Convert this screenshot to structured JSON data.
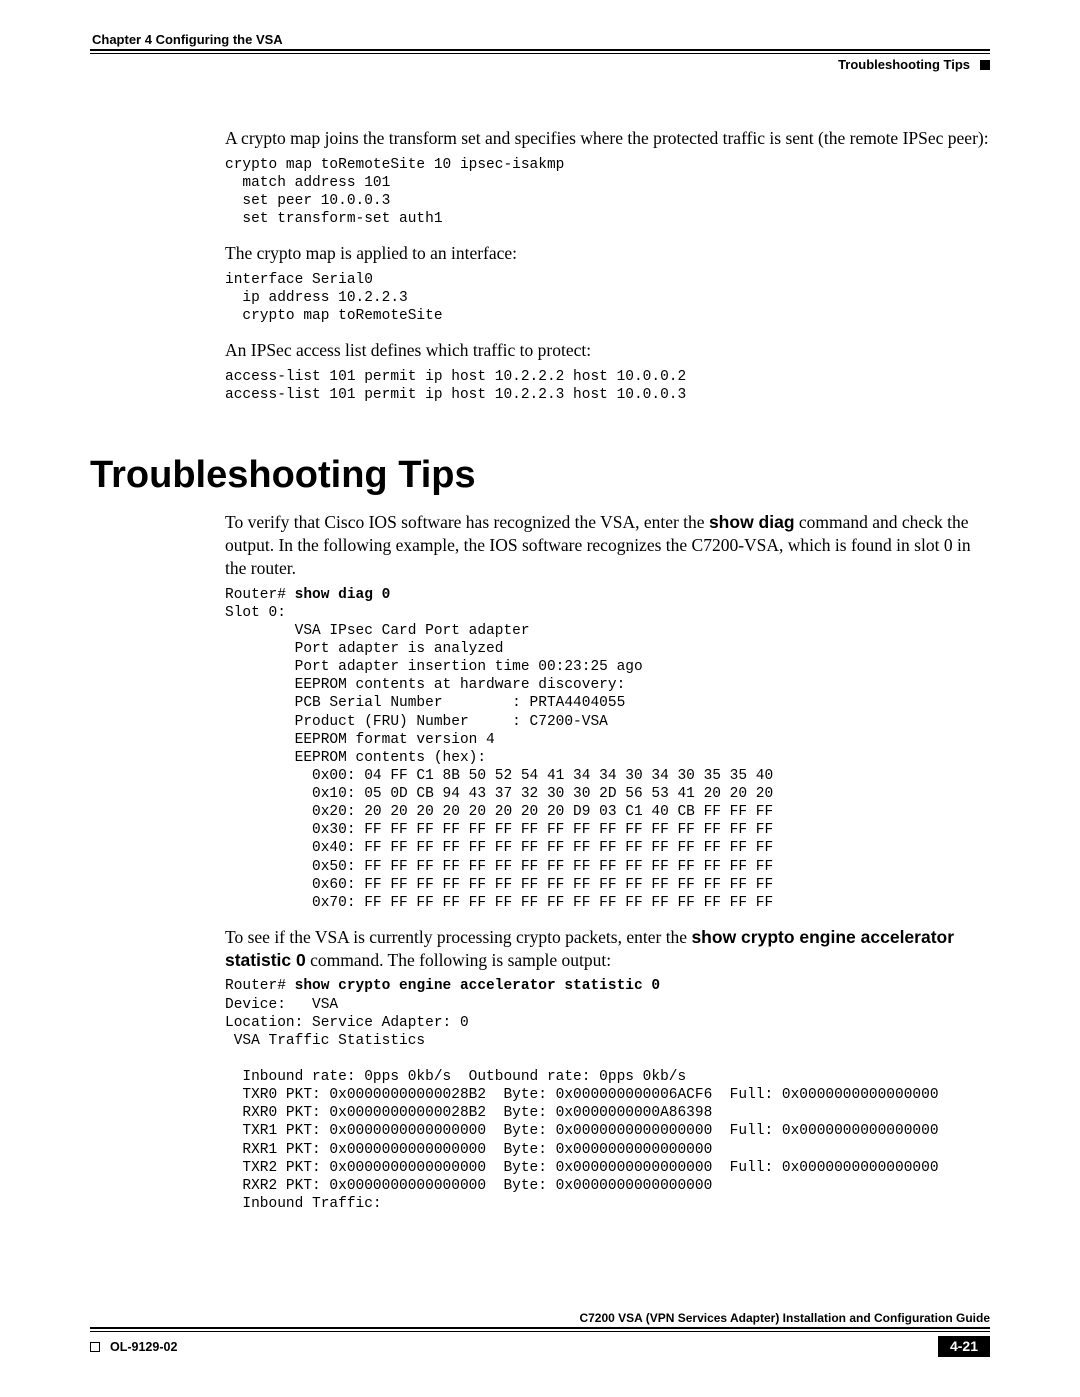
{
  "header": {
    "chapter": "Chapter 4    Configuring the VSA",
    "section": "Troubleshooting Tips"
  },
  "para1": "A crypto map joins the transform set and specifies where the protected traffic is sent (the remote IPSec peer):",
  "code1": "crypto map toRemoteSite 10 ipsec-isakmp\n  match address 101\n  set peer 10.0.0.3\n  set transform-set auth1",
  "para2": "The crypto map is applied to an interface:",
  "code2": "interface Serial0\n  ip address 10.2.2.3\n  crypto map toRemoteSite",
  "para3": "An IPSec access list defines which traffic to protect:",
  "code3": "access-list 101 permit ip host 10.2.2.2 host 10.0.0.2\naccess-list 101 permit ip host 10.2.2.3 host 10.0.0.3",
  "heading": "Troubleshooting Tips",
  "para4_a": "To verify that Cisco IOS software has recognized the VSA, enter the ",
  "para4_b": "show diag",
  "para4_c": " command and check the output. In the following example, the IOS software recognizes the C7200-VSA, which is found in slot 0 in the router.",
  "code4_prompt": "Router# ",
  "code4_cmd": "show diag 0",
  "code4_body": "Slot 0:\n        VSA IPsec Card Port adapter\n        Port adapter is analyzed\n        Port adapter insertion time 00:23:25 ago\n        EEPROM contents at hardware discovery:\n        PCB Serial Number        : PRTA4404055\n        Product (FRU) Number     : C7200-VSA\n        EEPROM format version 4\n        EEPROM contents (hex):\n          0x00: 04 FF C1 8B 50 52 54 41 34 34 30 34 30 35 35 40\n          0x10: 05 0D CB 94 43 37 32 30 30 2D 56 53 41 20 20 20\n          0x20: 20 20 20 20 20 20 20 20 D9 03 C1 40 CB FF FF FF\n          0x30: FF FF FF FF FF FF FF FF FF FF FF FF FF FF FF FF\n          0x40: FF FF FF FF FF FF FF FF FF FF FF FF FF FF FF FF\n          0x50: FF FF FF FF FF FF FF FF FF FF FF FF FF FF FF FF\n          0x60: FF FF FF FF FF FF FF FF FF FF FF FF FF FF FF FF\n          0x70: FF FF FF FF FF FF FF FF FF FF FF FF FF FF FF FF",
  "para5_a": "To see if the VSA is currently processing crypto packets, enter the ",
  "para5_b": "show crypto engine accelerator statistic 0",
  "para5_c": " command. The following is sample output:",
  "code5_prompt": "Router# ",
  "code5_cmd": "show crypto engine accelerator statistic 0",
  "code5_body": "\nDevice:   VSA\nLocation: Service Adapter: 0\n VSA Traffic Statistics\n\n  Inbound rate: 0pps 0kb/s  Outbound rate: 0pps 0kb/s\n  TXR0 PKT: 0x00000000000028B2  Byte: 0x000000000006ACF6  Full: 0x0000000000000000\n  RXR0 PKT: 0x00000000000028B2  Byte: 0x0000000000A86398\n  TXR1 PKT: 0x0000000000000000  Byte: 0x0000000000000000  Full: 0x0000000000000000\n  RXR1 PKT: 0x0000000000000000  Byte: 0x0000000000000000\n  TXR2 PKT: 0x0000000000000000  Byte: 0x0000000000000000  Full: 0x0000000000000000\n  RXR2 PKT: 0x0000000000000000  Byte: 0x0000000000000000\n  Inbound Traffic:",
  "footer": {
    "doc_title": "C7200 VSA (VPN Services Adapter) Installation and Configuration Guide",
    "doc_id": "OL-9129-02",
    "page_num": "4-21"
  }
}
